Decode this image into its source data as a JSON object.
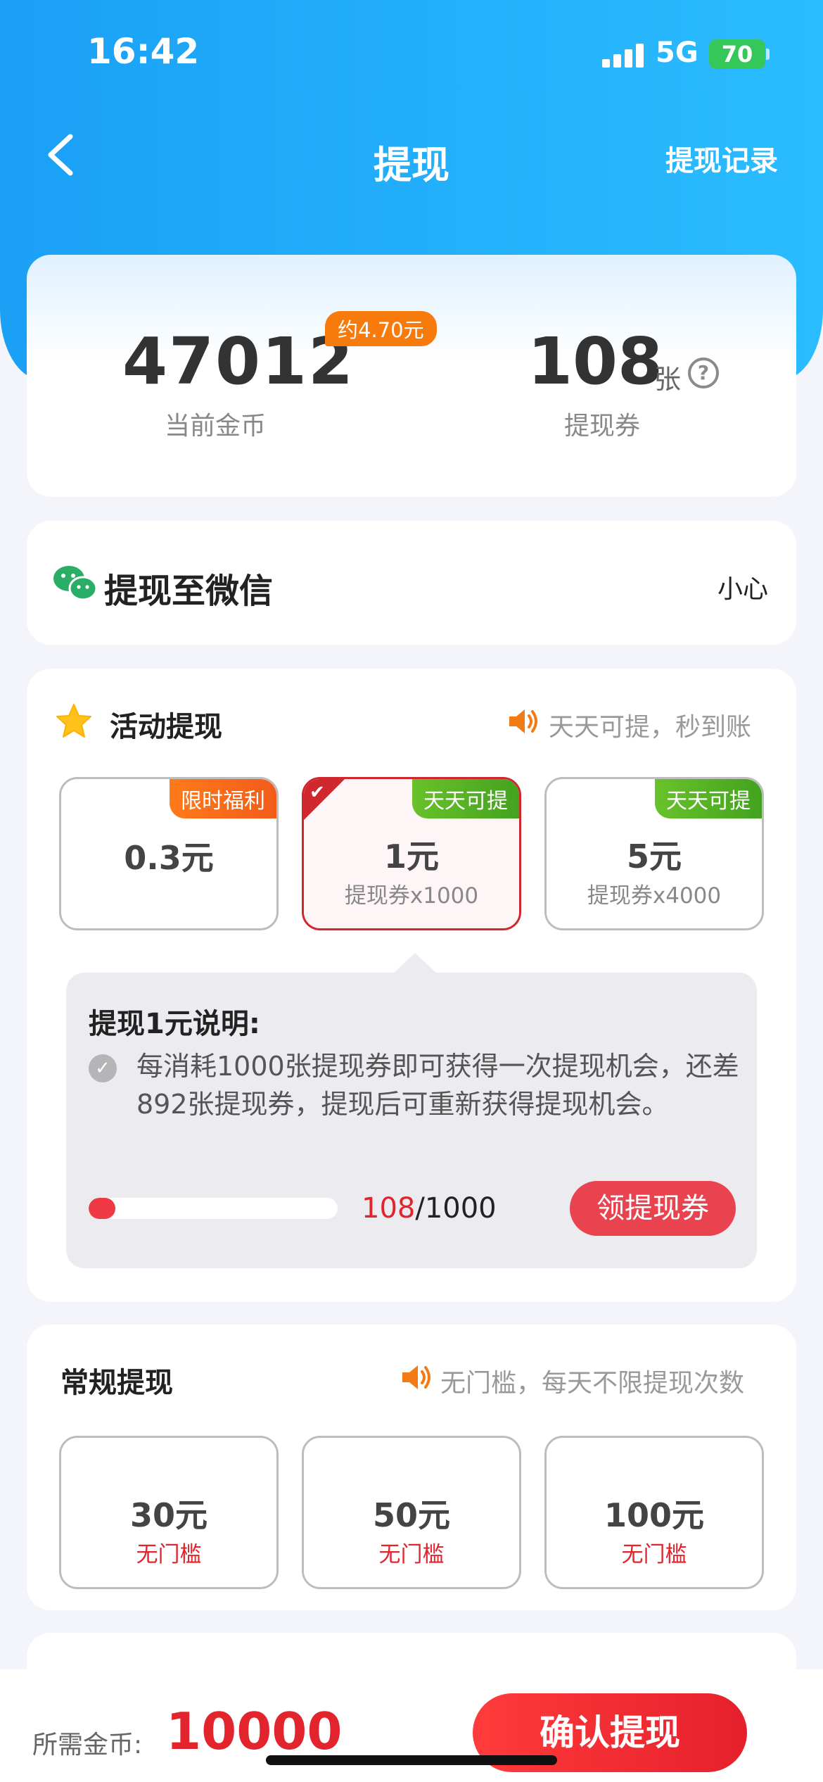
{
  "status_bar": {
    "time": "16:42",
    "network": "5G",
    "battery": "70"
  },
  "nav": {
    "title": "提现",
    "record_link": "提现记录"
  },
  "balance": {
    "coins": "47012",
    "coins_badge": "约4.70元",
    "coins_label": "当前金币",
    "vouchers": "108",
    "vouchers_unit": "张",
    "vouchers_label": "提现券"
  },
  "wechat": {
    "title": "提现至微信",
    "user": "小心"
  },
  "activity": {
    "title": "活动提现",
    "hint": "天天可提，秒到账",
    "options": [
      {
        "amount": "0.3元",
        "sub": "",
        "tag": "限时福利",
        "selected": false
      },
      {
        "amount": "1元",
        "sub": "提现券x1000",
        "tag": "天天可提",
        "selected": true
      },
      {
        "amount": "5元",
        "sub": "提现券x4000",
        "tag": "天天可提",
        "selected": false
      }
    ],
    "explain": {
      "title": "提现1元说明:",
      "text": "每消耗1000张提现券即可获得一次提现机会，还差892张提现券，提现后可重新获得提现机会。",
      "progress_current": "108",
      "progress_total": "/1000",
      "progress_fraction": 0.108,
      "claim_button": "领提现券"
    }
  },
  "regular": {
    "title": "常规提现",
    "hint": "无门槛，每天不限提现次数",
    "options": [
      {
        "amount": "30元",
        "sub": "无门槛"
      },
      {
        "amount": "50元",
        "sub": "无门槛"
      },
      {
        "amount": "100元",
        "sub": "无门槛"
      }
    ]
  },
  "bottom": {
    "need_label": "所需金币:",
    "need_value": "10000",
    "confirm_button": "确认提现"
  }
}
